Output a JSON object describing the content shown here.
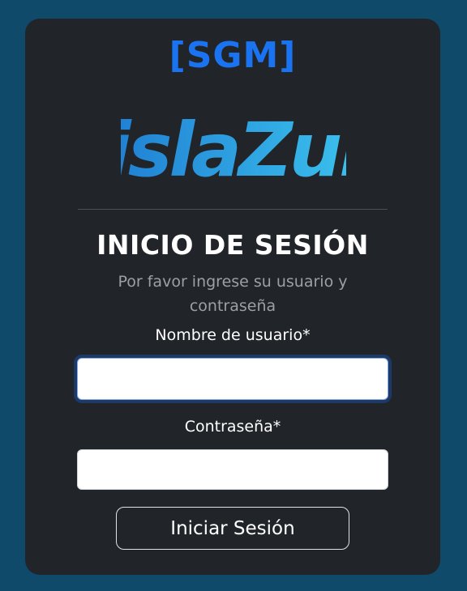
{
  "system_tag": "[SGM]",
  "brand": {
    "logo_text": "islaZul",
    "tag_color": "#1a73f0",
    "logo_color_left": "#1f7ed3",
    "logo_color_right": "#3cc3ee"
  },
  "login": {
    "title": "INICIO DE SESIÓN",
    "subtitle": "Por favor ingrese su usuario y contraseña",
    "username_label": "Nombre de usuario*",
    "username_value": "",
    "password_label": "Contraseña*",
    "password_value": "",
    "submit_label": "Iniciar Sesión"
  }
}
